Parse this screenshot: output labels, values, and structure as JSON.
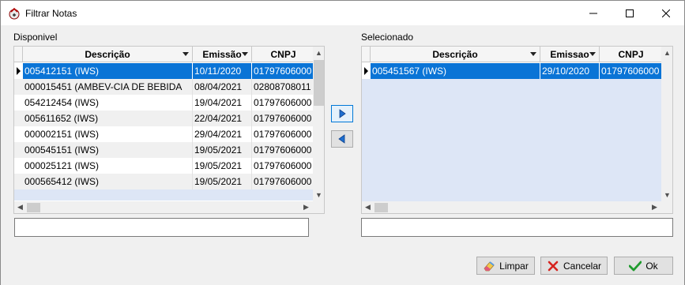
{
  "window": {
    "title": "Filtrar Notas"
  },
  "available": {
    "label": "Disponivel",
    "columns": [
      "Descrição",
      "Emissão",
      "CNPJ"
    ],
    "rows": [
      [
        "005412151 (IWS)",
        "10/11/2020",
        "01797606000"
      ],
      [
        "000015451 (AMBEV-CIA DE BEBIDA",
        "08/04/2021",
        "02808708011"
      ],
      [
        "054212454 (IWS)",
        "19/04/2021",
        "01797606000"
      ],
      [
        "005611652 (IWS)",
        "22/04/2021",
        "01797606000"
      ],
      [
        "000002151 (IWS)",
        "29/04/2021",
        "01797606000"
      ],
      [
        "000545151 (IWS)",
        "19/05/2021",
        "01797606000"
      ],
      [
        "000025121 (IWS)",
        "19/05/2021",
        "01797606000"
      ],
      [
        "000565412 (IWS)",
        "19/05/2021",
        "01797606000"
      ]
    ],
    "selected_row": 0,
    "search_value": ""
  },
  "selected": {
    "label": "Selecionado",
    "columns": [
      "Descrição",
      "Emissao",
      "CNPJ"
    ],
    "rows": [
      [
        "005451567 (IWS)",
        "29/10/2020",
        "01797606000"
      ]
    ],
    "selected_row": 0,
    "search_value": ""
  },
  "buttons": {
    "clear": "Limpar",
    "cancel": "Cancelar",
    "ok": "Ok"
  },
  "icons": {
    "app": "app-icon",
    "add": "arrow-right-icon",
    "remove": "arrow-left-icon",
    "clear": "eraser-icon",
    "cancel": "x-icon",
    "ok": "check-icon"
  },
  "colors": {
    "selection": "#0a74d6",
    "empty_area": "#dde6f6",
    "arrow_blue": "#1e6fd0"
  }
}
